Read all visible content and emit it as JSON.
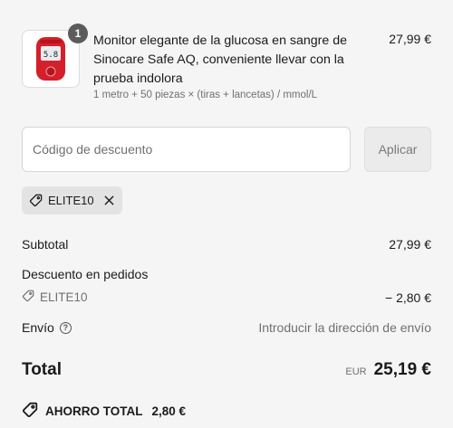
{
  "product": {
    "quantity_badge": "1",
    "title": "Monitor elegante de la glucosa en sangre de Sinocare Safe AQ, conveniente llevar con la prueba indolora",
    "variant": "1 metro + 50 piezas × (tiras + lancetas) / mmol/L",
    "price": "27,99 €",
    "image_icon": "glucose-meter-image",
    "meter_reading": "5.8"
  },
  "discount": {
    "placeholder": "Código de descuento",
    "value": "",
    "apply_label": "Aplicar",
    "applied_code": "ELITE10"
  },
  "summary": {
    "subtotal_label": "Subtotal",
    "subtotal_value": "27,99 €",
    "order_discount_label": "Descuento en pedidos",
    "order_discount_code": "ELITE10",
    "order_discount_value": "− 2,80 €",
    "shipping_label": "Envío",
    "shipping_help_icon": "help-circle-icon",
    "shipping_value": "Introducir la dirección de envío",
    "total_label": "Total",
    "currency": "EUR",
    "total_value": "25,19 €",
    "savings_label": "AHORRO TOTAL",
    "savings_value": "2,80 €"
  },
  "colors": {
    "background": "#f5f5f5",
    "accent_red": "#d3202a",
    "badge": "#5c5c5c",
    "muted_text": "#707070"
  }
}
